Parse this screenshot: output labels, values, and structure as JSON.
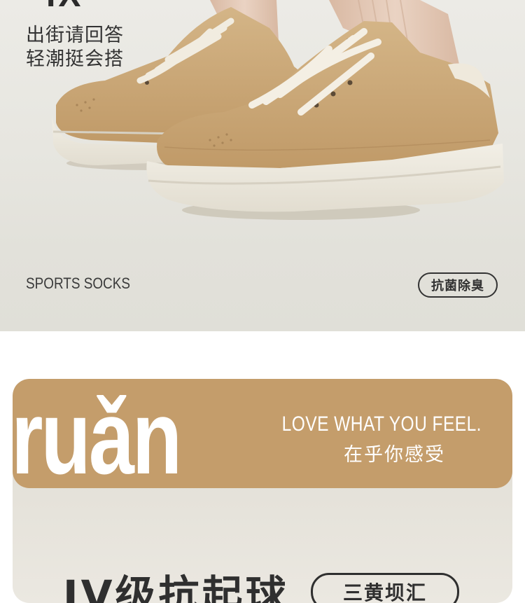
{
  "hero": {
    "headline_fragment": "IX",
    "tagline_lines": [
      "出街请回答",
      "轻潮挺会搭"
    ],
    "label_en": "SPORTS SOCKS",
    "badge": "抗菌除臭",
    "colors": {
      "shoe_suede": "#c9a87a",
      "sole": "#eeeae0",
      "sock": "#e3c7b3",
      "text": "#333333"
    }
  },
  "feature": {
    "word": "ruǎn",
    "slogan_en": "LOVE WHAT YOU FEEL.",
    "slogan_cn": "在乎你感受",
    "title": "IV级抗起球",
    "badge": "三黄坝汇",
    "colors": {
      "banner": "#c49d6b",
      "card": "#e4e1d9"
    }
  }
}
